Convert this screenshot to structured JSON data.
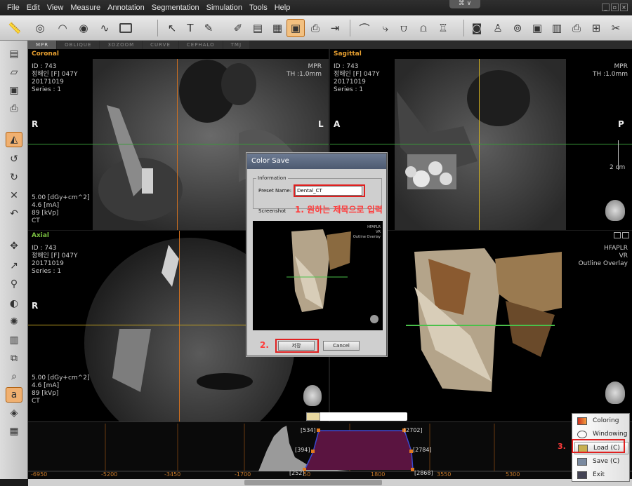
{
  "menu": [
    "File",
    "Edit",
    "View",
    "Measure",
    "Annotation",
    "Segmentation",
    "Simulation",
    "Tools",
    "Help"
  ],
  "top_drop": "⌘ ∨",
  "tabs": [
    "MPR",
    "OBLIQUE",
    "3DZOOM",
    "CURVE",
    "CEPHALO",
    "TMJ"
  ],
  "coronal": {
    "title": "Coronal",
    "info": [
      "ID : 743",
      "정해인 [F] 047Y",
      "20171019",
      "Series : 1"
    ],
    "right": [
      "MPR",
      "TH :1.0mm"
    ],
    "dose": [
      "5.00 [dGy+cm^2]",
      "4.6 [mA]",
      "89 [kVp]",
      "CT"
    ],
    "dir_left": "R",
    "dir_right": "L"
  },
  "sagittal": {
    "title": "Sagittal",
    "info": [
      "ID : 743",
      "정해인 [F] 047Y",
      "20171019",
      "Series : 1"
    ],
    "right": [
      "MPR",
      "TH :1.0mm"
    ],
    "dir_left": "A",
    "dir_right": "P",
    "scale": "2 cm"
  },
  "axial": {
    "title": "Axial",
    "info": [
      "ID : 743",
      "정해인 [F] 047Y",
      "20171019",
      "Series : 1"
    ],
    "dose": [
      "5.00 [dGy+cm^2]",
      "4.6 [mA]",
      "89 [kVp]",
      "CT"
    ],
    "dir_left": "R"
  },
  "vr": {
    "right": [
      "HFAPLR",
      "VR",
      "Outline Overlay"
    ]
  },
  "dialog": {
    "title": "Color Save",
    "group": "Information",
    "preset_label": "Preset Name:",
    "preset_value": "Dental_CT",
    "screenshot_label": "Screenshot",
    "thumb_text": [
      "HFAPLR",
      "VR",
      "Outline Overlay"
    ],
    "save_label": "저장",
    "cancel_label": "Cancel"
  },
  "annotations": {
    "a1": "1. 원하는 제목으로 입력",
    "a2": "2.",
    "a3": "3."
  },
  "histogram": {
    "points": [
      "[534]",
      "[2702]",
      "[394]",
      "[2784]",
      "[252]",
      "[2868]"
    ],
    "x_ticks": [
      "-6950",
      "-5200",
      "-3450",
      "-1700",
      "1800",
      "3550",
      "5300"
    ],
    "tick_partial": "50"
  },
  "context_menu": [
    "Coloring",
    "Windowing",
    "Load (C)",
    "Save (C)",
    "Exit"
  ],
  "colors": {
    "orange_title": "#e8a030",
    "green_title": "#7ac040",
    "annotation_red": "#ff3b3b",
    "histo_fill": "#5a1440"
  }
}
